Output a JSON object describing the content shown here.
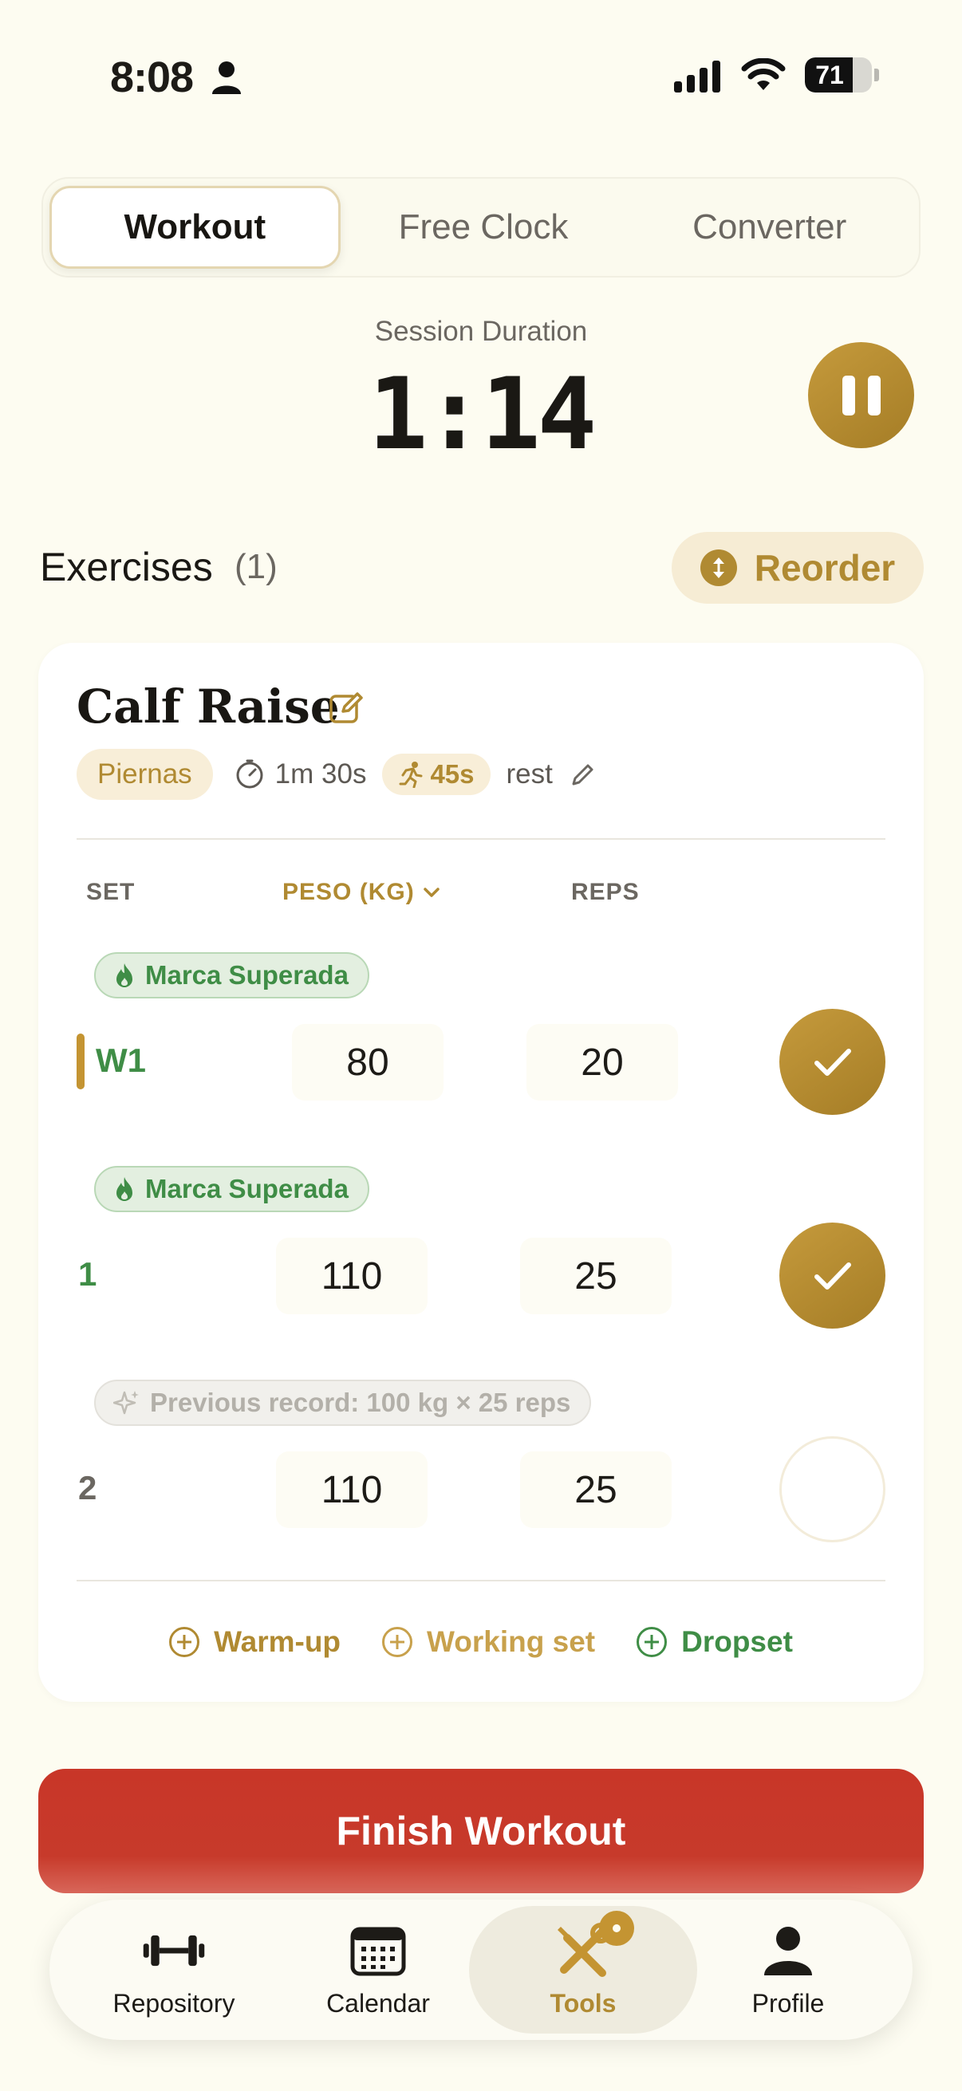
{
  "status_bar": {
    "time": "8:08",
    "battery": "71",
    "battery_level": 0.71
  },
  "tabs": [
    {
      "label": "Workout",
      "active": true
    },
    {
      "label": "Free Clock",
      "active": false
    },
    {
      "label": "Converter",
      "active": false
    }
  ],
  "session": {
    "label": "Session Duration",
    "time": "1:14"
  },
  "exercises": {
    "title": "Exercises",
    "count": "(1)",
    "reorder_label": "Reorder"
  },
  "exercise_card": {
    "name": "Calf Raise",
    "muscle_tag": "Piernas",
    "duration": "1m 30s",
    "rest_value": "45s",
    "rest_label": "rest",
    "columns": {
      "set": "SET",
      "weight": "PESO (KG)",
      "reps": "REPS"
    },
    "sets": [
      {
        "label": "W1",
        "badge": "Marca Superada",
        "weight": "80",
        "reps": "20",
        "completed": true,
        "type": "warm-up"
      },
      {
        "label": "1",
        "badge": "Marca Superada",
        "weight": "110",
        "reps": "25",
        "completed": true,
        "type": "working"
      },
      {
        "label": "2",
        "badge": "Previous record: 100 kg × 25 reps",
        "weight": "110",
        "reps": "25",
        "completed": false,
        "type": "working"
      }
    ],
    "add_buttons": {
      "warmup": "Warm-up",
      "working": "Working set",
      "dropset": "Dropset"
    }
  },
  "finish_label": "Finish Workout",
  "bottom_nav": [
    {
      "label": "Repository",
      "icon": "dumbbell-icon"
    },
    {
      "label": "Calendar",
      "icon": "calendar-icon"
    },
    {
      "label": "Tools",
      "icon": "tools-icon",
      "active": true
    },
    {
      "label": "Profile",
      "icon": "profile-icon"
    }
  ],
  "colors": {
    "background": "#fdfcf1",
    "accent_gold": "#b08a32",
    "success_green": "#3f8d46",
    "danger_red": "#c83628"
  }
}
